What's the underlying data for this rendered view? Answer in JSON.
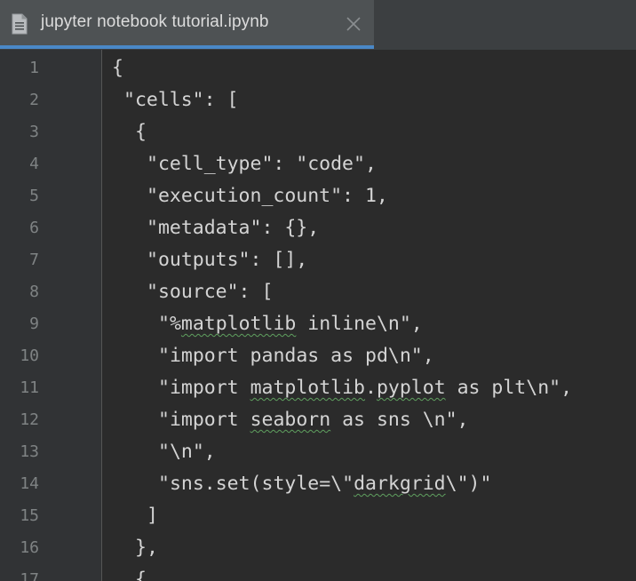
{
  "tab": {
    "title": "jupyter notebook tutorial.ipynb",
    "icon": "file-icon",
    "close_icon": "close-icon",
    "accent_color": "#4a88c7"
  },
  "editor": {
    "lines": [
      {
        "number": "1",
        "indent": 0,
        "segments": [
          {
            "text": "{"
          }
        ]
      },
      {
        "number": "2",
        "indent": 1,
        "segments": [
          {
            "text": "\"cells\": ["
          }
        ]
      },
      {
        "number": "3",
        "indent": 2,
        "segments": [
          {
            "text": "{"
          }
        ]
      },
      {
        "number": "4",
        "indent": 3,
        "segments": [
          {
            "text": "\"cell_type\": \"code\","
          }
        ]
      },
      {
        "number": "5",
        "indent": 3,
        "segments": [
          {
            "text": "\"execution_count\": 1,"
          }
        ]
      },
      {
        "number": "6",
        "indent": 3,
        "segments": [
          {
            "text": "\"metadata\": {},"
          }
        ]
      },
      {
        "number": "7",
        "indent": 3,
        "segments": [
          {
            "text": "\"outputs\": [],"
          }
        ]
      },
      {
        "number": "8",
        "indent": 3,
        "segments": [
          {
            "text": "\"source\": ["
          }
        ]
      },
      {
        "number": "9",
        "indent": 4,
        "segments": [
          {
            "text": "\"%"
          },
          {
            "text": "matplotlib",
            "typo": true
          },
          {
            "text": " inline\\n\","
          }
        ]
      },
      {
        "number": "10",
        "indent": 4,
        "segments": [
          {
            "text": "\"import pandas as pd\\n\","
          }
        ]
      },
      {
        "number": "11",
        "indent": 4,
        "segments": [
          {
            "text": "\"import "
          },
          {
            "text": "matplotlib",
            "typo": true
          },
          {
            "text": "."
          },
          {
            "text": "pyplot",
            "typo": true
          },
          {
            "text": " as plt\\n\","
          }
        ]
      },
      {
        "number": "12",
        "indent": 4,
        "segments": [
          {
            "text": "\"import "
          },
          {
            "text": "seaborn",
            "typo": true
          },
          {
            "text": " as sns \\n\","
          }
        ]
      },
      {
        "number": "13",
        "indent": 4,
        "segments": [
          {
            "text": "\"\\n\","
          }
        ]
      },
      {
        "number": "14",
        "indent": 4,
        "segments": [
          {
            "text": "\"sns.set(style=\\\""
          },
          {
            "text": "darkgrid",
            "typo": true
          },
          {
            "text": "\\\")\""
          }
        ]
      },
      {
        "number": "15",
        "indent": 3,
        "segments": [
          {
            "text": "]"
          }
        ]
      },
      {
        "number": "16",
        "indent": 2,
        "segments": [
          {
            "text": "},"
          }
        ]
      },
      {
        "number": "17",
        "indent": 2,
        "segments": [
          {
            "text": "{"
          }
        ]
      }
    ]
  },
  "colors": {
    "editor_bg": "#2b2b2b",
    "gutter_bg": "#313335",
    "tab_bg": "#4e5254",
    "text": "#d4d4d4",
    "line_number": "#7f8384",
    "typo_underline": "#5fa05f"
  }
}
